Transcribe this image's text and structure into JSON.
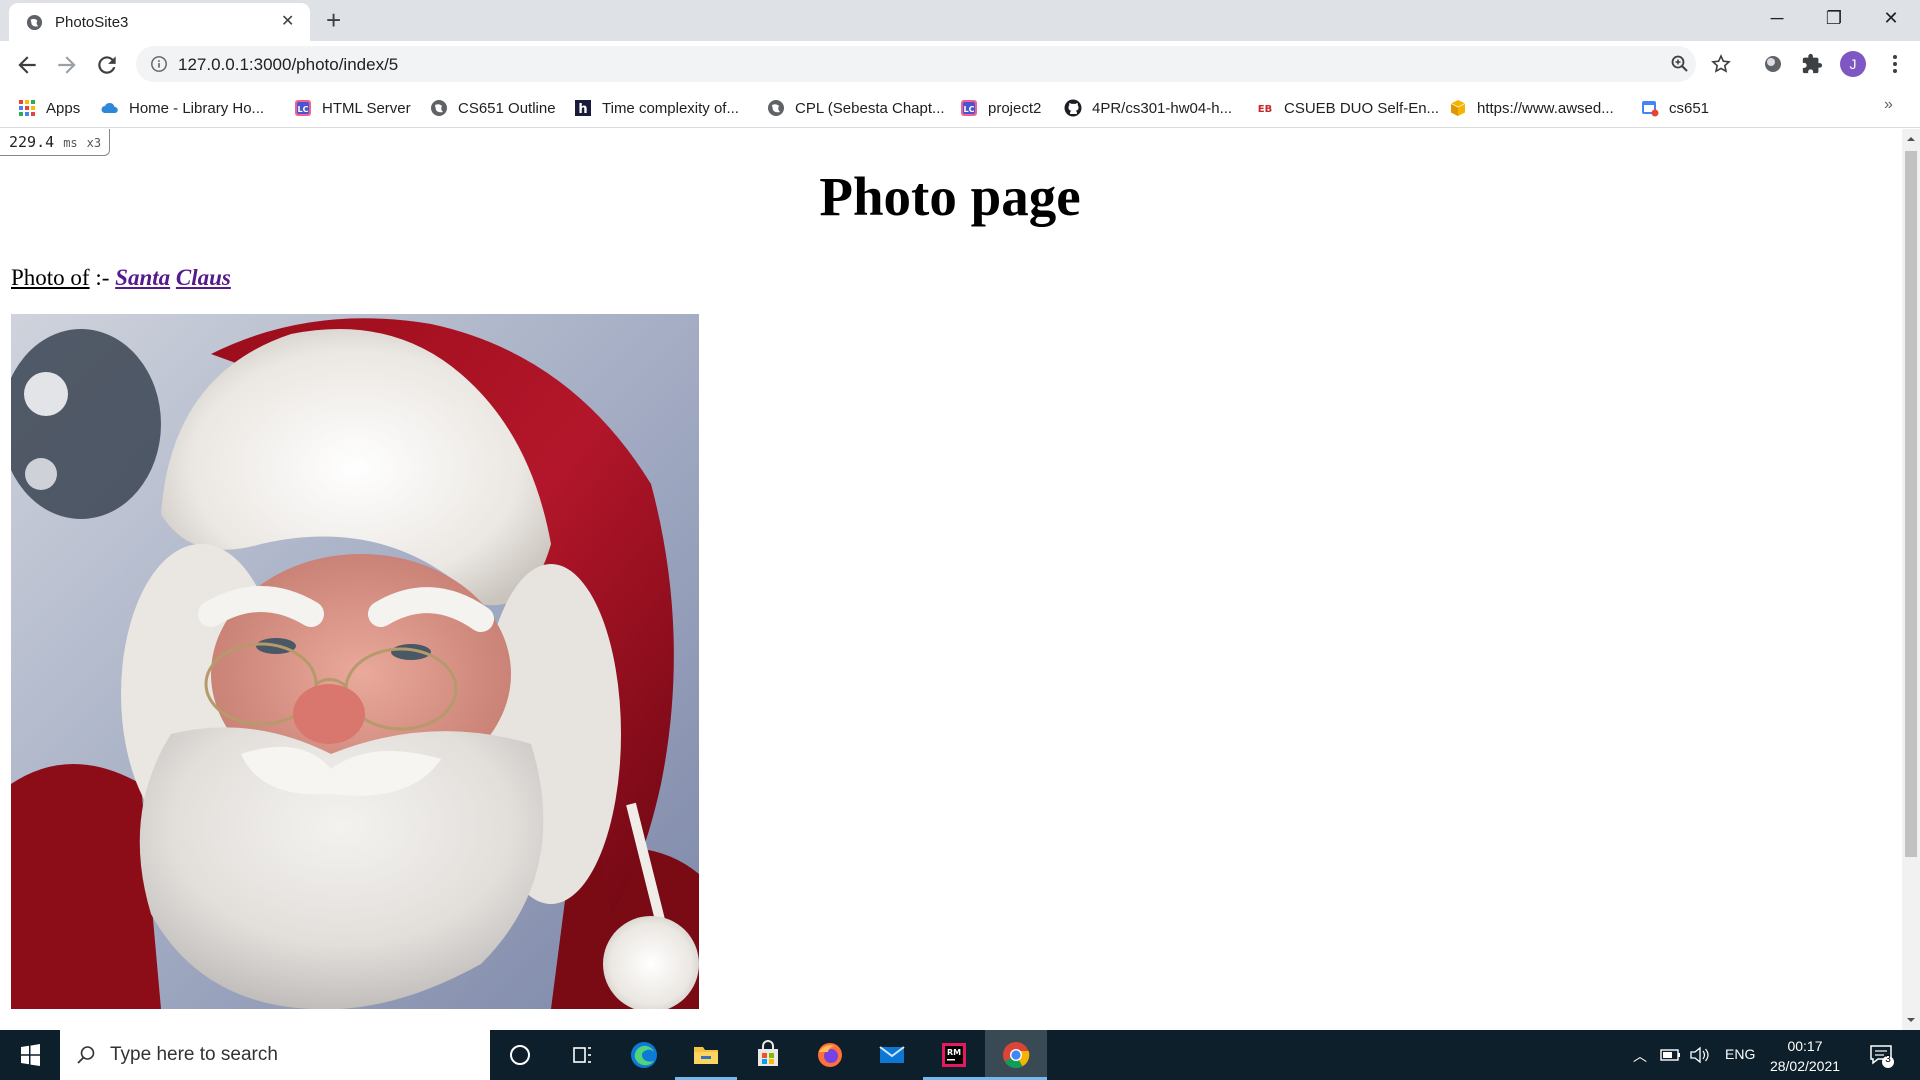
{
  "browser": {
    "tab_title": "PhotoSite3",
    "url": "127.0.0.1:3000/photo/index/5",
    "profile_initial": "J",
    "bookmarks": [
      {
        "label": "Apps",
        "icon": "apps-grid-icon"
      },
      {
        "label": "Home - Library Ho...",
        "icon": "cloud-icon"
      },
      {
        "label": "HTML Server",
        "icon": "leetcode-icon"
      },
      {
        "label": "CS651 Outline",
        "icon": "globe-icon"
      },
      {
        "label": "Time complexity of...",
        "icon": "h-logo-icon"
      },
      {
        "label": "CPL (Sebesta Chapt...",
        "icon": "globe-icon"
      },
      {
        "label": "project2",
        "icon": "leetcode-icon"
      },
      {
        "label": "4PR/cs301-hw04-h...",
        "icon": "github-icon"
      },
      {
        "label": "CSUEB DUO Self-En...",
        "icon": "eb-logo-icon"
      },
      {
        "label": "https://www.awsed...",
        "icon": "box-icon"
      },
      {
        "label": "cs651",
        "icon": "calendar-icon"
      }
    ],
    "more_bookmarks": "»"
  },
  "page": {
    "perf_value": "229.4",
    "perf_unit": "ms",
    "perf_count": "x3",
    "title": "Photo page",
    "photo_of_label": "Photo of",
    "separator": " :- ",
    "first_name": "Santa",
    "last_name": "Claus"
  },
  "taskbar": {
    "search_placeholder": "Type here to search",
    "language": "ENG",
    "time": "00:17",
    "date": "28/02/2021",
    "notification_count": "3"
  }
}
